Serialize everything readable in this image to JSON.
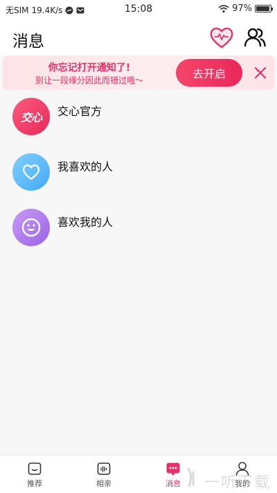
{
  "status_bar": {
    "carrier": "无SIM",
    "speed": "19.4K/s",
    "time": "15:08",
    "battery": "97%",
    "battery_level": 0.97
  },
  "header": {
    "title": "消息",
    "heart_icon": "heart-pulse-icon",
    "users_icon": "users-icon"
  },
  "banner": {
    "title": "你忘记打开通知了!",
    "subtitle": "别让一段缘分因此而错过哦～",
    "button_label": "去开启",
    "close_icon": "close-icon"
  },
  "conversations": [
    {
      "label": "交心官方",
      "avatar_text": "交心",
      "icon": "jiaoxin-logo",
      "color_from": "#fb5c7f",
      "color_to": "#e6295a"
    },
    {
      "label": "我喜欢的人",
      "icon": "heart-outline-icon",
      "color_from": "#7fd0ff",
      "color_to": "#45a9f5"
    },
    {
      "label": "喜欢我的人",
      "icon": "smile-icon",
      "color_from": "#c79bf6",
      "color_to": "#9b62e6"
    }
  ],
  "tabs": [
    {
      "label": "推荐",
      "icon": "home-icon",
      "active": false
    },
    {
      "label": "相亲",
      "icon": "voice-icon",
      "active": false
    },
    {
      "label": "消息",
      "icon": "message-icon",
      "active": true
    },
    {
      "label": "我的",
      "icon": "profile-icon",
      "active": false
    }
  ],
  "watermark": {
    "text": "一听下载"
  },
  "colors": {
    "accent": "#e3336a",
    "background": "#f7f7f7"
  }
}
